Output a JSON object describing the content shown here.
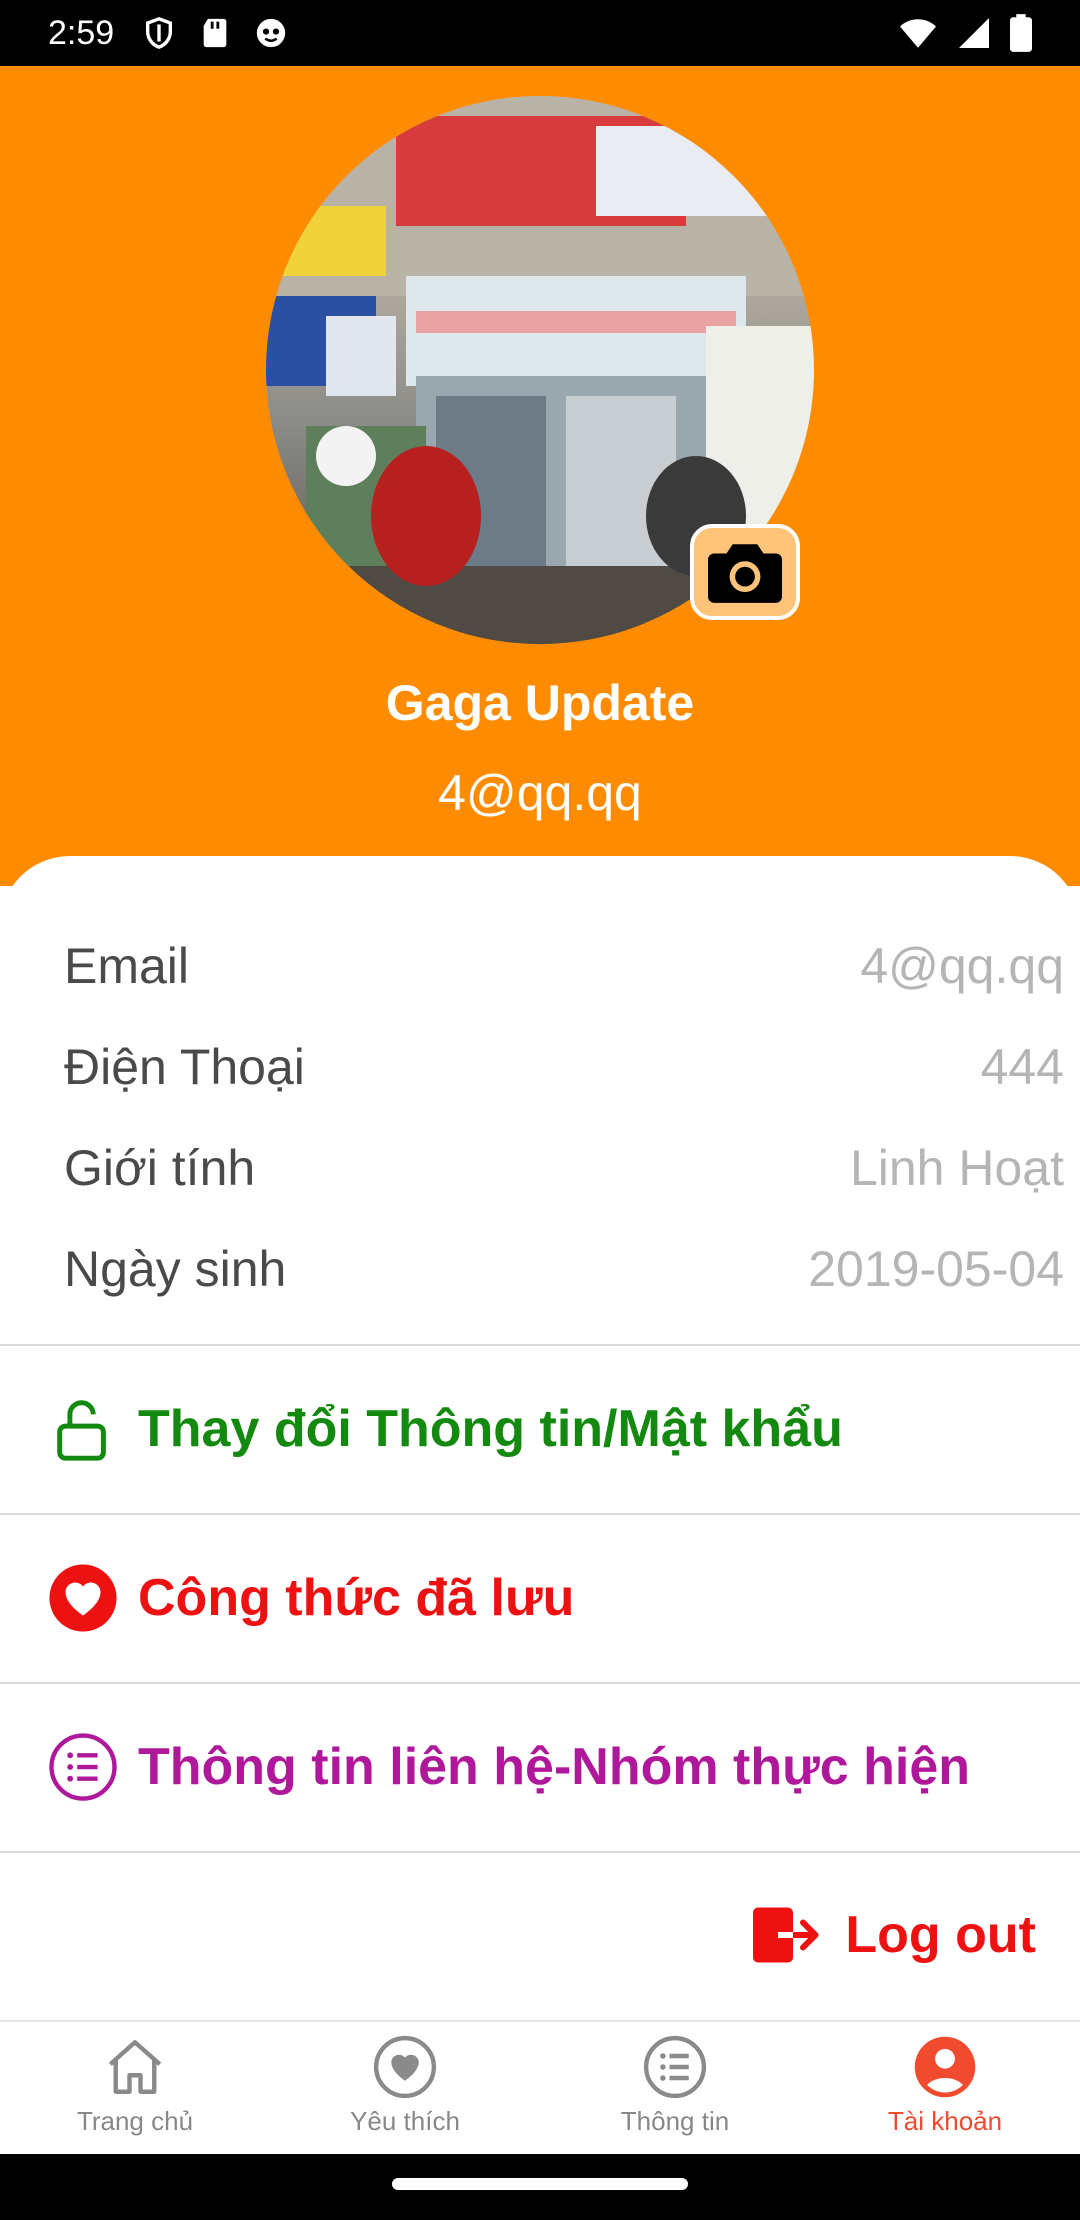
{
  "status_bar": {
    "time": "2:59"
  },
  "profile": {
    "name": "Gaga Update",
    "email": "4@qq.qq"
  },
  "info": [
    {
      "label": "Email",
      "value": "4@qq.qq"
    },
    {
      "label": "Điện Thoại",
      "value": "444"
    },
    {
      "label": "Giới tính",
      "value": "Linh Hoạt"
    },
    {
      "label": "Ngày sinh",
      "value": "2019-05-04"
    }
  ],
  "menu": {
    "change_info": "Thay đổi Thông tin/Mật khẩu",
    "saved_recipes": "Công thức đã lưu",
    "contact_info": "Thông tin liên hệ-Nhóm thực hiện",
    "logout": "Log out"
  },
  "colors": {
    "header": "#ff8c00",
    "change_info": "#138a0f",
    "saved_recipes": "#ee1111",
    "contact_info": "#b0189b",
    "logout": "#ee1111",
    "nav_active": "#f04b2f"
  },
  "nav": [
    {
      "label": "Trang chủ",
      "icon": "home-icon"
    },
    {
      "label": "Yêu thích",
      "icon": "heart-icon"
    },
    {
      "label": "Thông tin",
      "icon": "list-icon"
    },
    {
      "label": "Tài khoản",
      "icon": "account-icon",
      "active": true
    }
  ]
}
